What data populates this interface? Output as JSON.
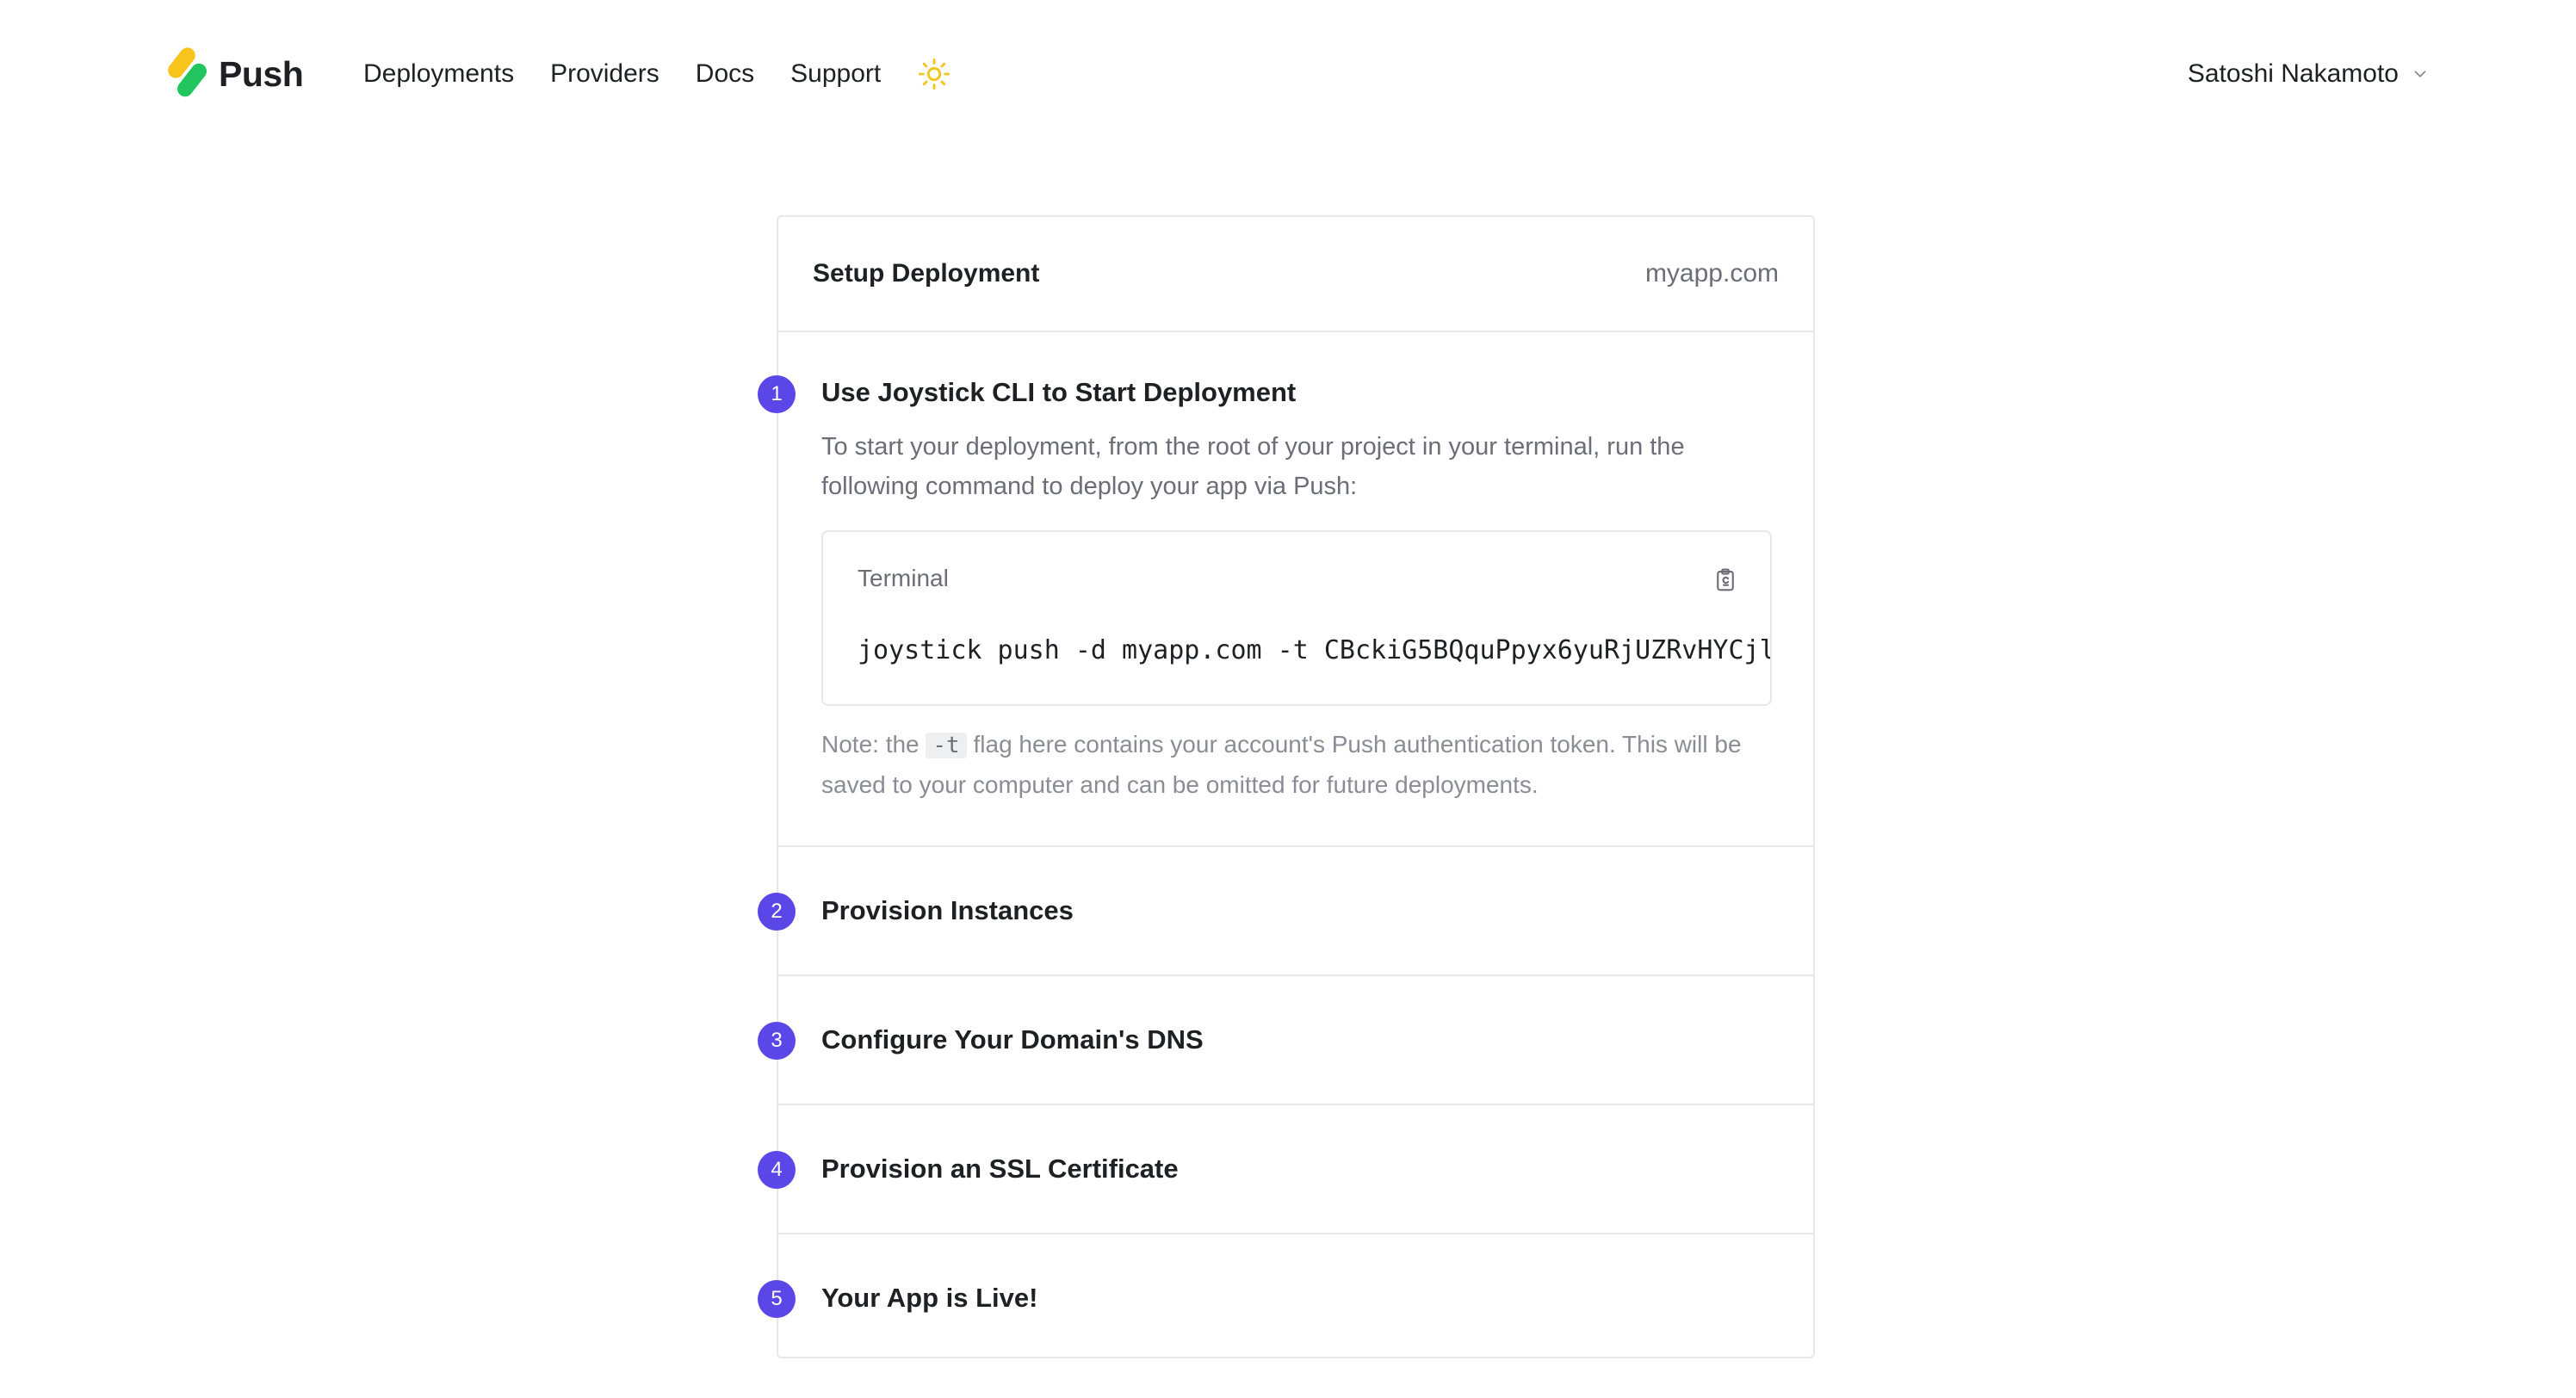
{
  "app": {
    "name": "Push",
    "brand_colors": {
      "yellow": "#f6c41a",
      "green": "#22c55e",
      "accent": "#5b47e8"
    }
  },
  "nav": {
    "links": [
      "Deployments",
      "Providers",
      "Docs",
      "Support"
    ],
    "theme_icon": "sun-icon",
    "theme_color": "#f6c41a"
  },
  "user": {
    "name": "Satoshi Nakamoto",
    "menu_icon": "chevron-down-icon"
  },
  "setup": {
    "title": "Setup Deployment",
    "domain": "myapp.com",
    "steps": [
      {
        "number": "1",
        "title": "Use Joystick CLI to Start Deployment",
        "description": "To start your deployment, from the root of your project in your terminal, run the following command to deploy your app via Push:",
        "terminal": {
          "label": "Terminal",
          "command": "joystick push -d myapp.com -t CBckiG5BQquPpyx6yuRjUZRvHYCjl",
          "copy_icon": "clipboard-icon"
        },
        "note_before": "Note: the ",
        "note_code": "-t",
        "note_after": " flag here contains your account's Push authentication token. This will be saved to your computer and can be omitted for future deployments."
      },
      {
        "number": "2",
        "title": "Provision Instances"
      },
      {
        "number": "3",
        "title": "Configure Your Domain's DNS"
      },
      {
        "number": "4",
        "title": "Provision an SSL Certificate"
      },
      {
        "number": "5",
        "title": "Your App is Live!"
      }
    ]
  }
}
